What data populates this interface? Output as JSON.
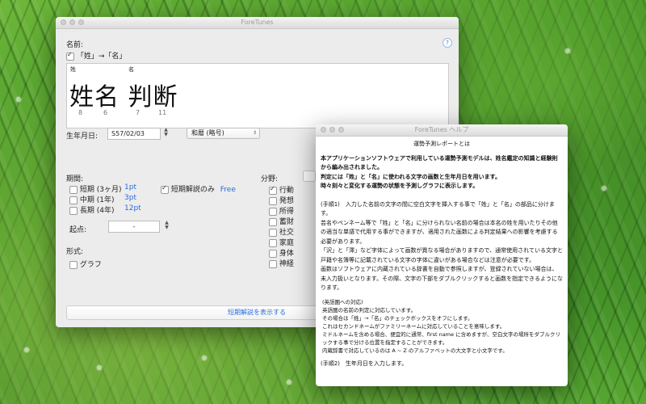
{
  "main_window": {
    "title": "ForeTunes",
    "name_label": "名前:",
    "sei_mei_checkbox_label": "「姓」→「名」",
    "surname_label": "姓",
    "given_label": "名",
    "name_display": "姓名 判断",
    "stroke_counts": [
      "8",
      "6",
      "7",
      "11"
    ],
    "birthdate_label": "生年月日:",
    "birthdate_value": "S57/02/03",
    "era_select": "和暦 (略号)",
    "period_label": "期間:",
    "period_options": [
      {
        "label": "短期 (3ヶ月)",
        "value": "1pt",
        "checked": false
      },
      {
        "label": "中期 (1年)",
        "value": "3pt",
        "checked": false
      },
      {
        "label": "長期 (4年)",
        "value": "12pt",
        "checked": false
      }
    ],
    "short_only_label": "短期解説のみ",
    "short_only_value": "Free",
    "start_label": "起点:",
    "start_value": "-",
    "format_label": "形式:",
    "graph_label": "グラフ",
    "field_label": "分野:",
    "fields": [
      {
        "label": "行動",
        "checked": true
      },
      {
        "label": "発想",
        "checked": false
      },
      {
        "label": "所得",
        "checked": false
      },
      {
        "label": "蓄財",
        "checked": false
      },
      {
        "label": "社交",
        "checked": false
      },
      {
        "label": "家庭",
        "checked": false
      },
      {
        "label": "身体",
        "checked": false
      },
      {
        "label": "神経",
        "checked": false
      }
    ],
    "show_button": "短期解説を表示する",
    "help_icon_label": "?"
  },
  "help_window": {
    "title": "ForeTunes ヘルプ",
    "heading": "運勢予測レポートとは",
    "intro": [
      "本アプリケーションソフトウェアで利用している運勢予測モデルは、姓名鑑定の知識と経験則から編み出されました。",
      "判定には「姓」と「名」に使われる文字の画数と生年月日を用います。",
      "時々刻々と変化する運勢の状態を予測しグラフに表示します。"
    ],
    "step1_paragraphs": [
      "(手順1)　入力した名前の文字の間に空白文字を挿入する事で「姓」と「名」の部品に分けます。",
      "芸名やペンネーム等で「姓」と「名」に分けられない名前の場合は本名の姓を用いたりその他の適当な単語で代用する事ができますが、適用された画数による判定結果への影響を考慮する必要があります。",
      "「沢」と「澤」など字体によって画数が異なる場合がありますので、通常使用されている文字と戸籍や名簿等に記載されている文字の字体に違いがある場合などは注意が必要です。",
      "画数はソフトウェアに内蔵されている辞書を自動で参照しますが、登録されていない場合は、未入力扱いとなります。その際、文字の下部をダブルクリックすると画数を指定できるようになります。"
    ],
    "english_paragraphs": [
      "(英語圏への対応)",
      "英語圏の名前の判定に対応しています。",
      "その場合は「姓」→「名」のチェックボックスをオフにします。",
      "これはセカンドネームがファミリーネームに対応していることを意味します。",
      "ミドルネームを含める場合、便宜的に通常、first name に含めますが、空白文字の場所をダブルクリックする事で分ける位置を指定することができます。",
      "内蔵辞書で対応しているのは A ~ Z のアルファベットの大文字と小文字です。"
    ],
    "step2": "(手順2)　生年月日を入力します。"
  }
}
